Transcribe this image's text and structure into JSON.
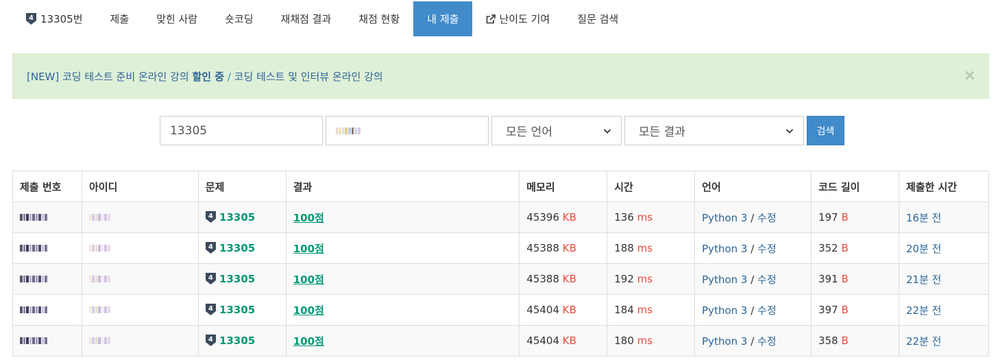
{
  "tabs": [
    {
      "label": "13305번",
      "name": "tab-problem",
      "tier": "4",
      "active": false
    },
    {
      "label": "제출",
      "name": "tab-submit",
      "active": false
    },
    {
      "label": "맞힌 사람",
      "name": "tab-solvers",
      "active": false
    },
    {
      "label": "숏코딩",
      "name": "tab-shortcoding",
      "active": false
    },
    {
      "label": "재채점 결과",
      "name": "tab-rejudge",
      "active": false
    },
    {
      "label": "채점 현황",
      "name": "tab-status",
      "active": false
    },
    {
      "label": "내 제출",
      "name": "tab-my-submissions",
      "active": true
    },
    {
      "label": "난이도 기여",
      "name": "tab-difficulty",
      "active": false,
      "icon": "external-link-icon"
    },
    {
      "label": "질문 검색",
      "name": "tab-question-search",
      "active": false
    }
  ],
  "alert": {
    "prefix": "[NEW] 코딩 테스트 준비 온라인 강의 ",
    "highlight": "할인 중",
    "separator": " / ",
    "link2": "코딩 테스트 및 인터뷰 온라인 강의",
    "close": "×"
  },
  "search": {
    "problem_value": "13305",
    "language_selected": "모든 언어",
    "result_selected": "모든 결과",
    "button_label": "검색"
  },
  "table": {
    "headers": [
      "제출 번호",
      "아이디",
      "문제",
      "결과",
      "메모리",
      "시간",
      "언어",
      "코드 길이",
      "제출한 시간"
    ],
    "rows": [
      {
        "problem": "13305",
        "tier": "4",
        "result": "100점",
        "memory": "45396",
        "memory_unit": "KB",
        "time": "136",
        "time_unit": "ms",
        "language": "Python 3",
        "sep": " / ",
        "edit": "수정",
        "code_len": "197",
        "code_unit": "B",
        "submitted": "16분 전"
      },
      {
        "problem": "13305",
        "tier": "4",
        "result": "100점",
        "memory": "45388",
        "memory_unit": "KB",
        "time": "188",
        "time_unit": "ms",
        "language": "Python 3",
        "sep": " / ",
        "edit": "수정",
        "code_len": "352",
        "code_unit": "B",
        "submitted": "20분 전"
      },
      {
        "problem": "13305",
        "tier": "4",
        "result": "100점",
        "memory": "45388",
        "memory_unit": "KB",
        "time": "192",
        "time_unit": "ms",
        "language": "Python 3",
        "sep": " / ",
        "edit": "수정",
        "code_len": "391",
        "code_unit": "B",
        "submitted": "21분 전"
      },
      {
        "problem": "13305",
        "tier": "4",
        "result": "100점",
        "memory": "45404",
        "memory_unit": "KB",
        "time": "184",
        "time_unit": "ms",
        "language": "Python 3",
        "sep": " / ",
        "edit": "수정",
        "code_len": "397",
        "code_unit": "B",
        "submitted": "22분 전"
      },
      {
        "problem": "13305",
        "tier": "4",
        "result": "100점",
        "memory": "45404",
        "memory_unit": "KB",
        "time": "180",
        "time_unit": "ms",
        "language": "Python 3",
        "sep": " / ",
        "edit": "수정",
        "code_len": "358",
        "code_unit": "B",
        "submitted": "22분 전"
      }
    ]
  },
  "colors": {
    "accent": "#428bca",
    "alert_bg": "#dff0d8",
    "success": "#009874",
    "unit": "#e74c3c",
    "link": "#2a6496",
    "tier_badge": "#3b4a5c"
  }
}
